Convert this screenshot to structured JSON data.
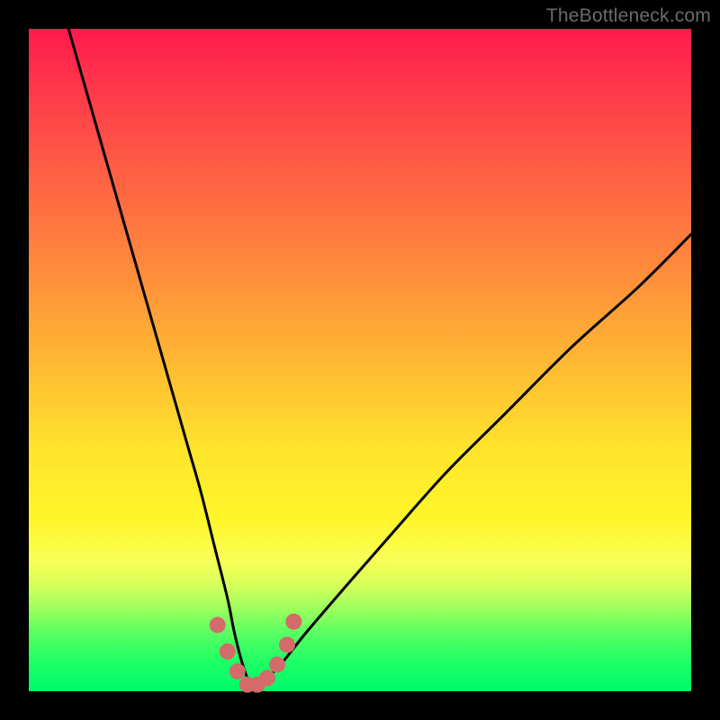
{
  "watermark": "TheBottleneck.com",
  "chart_data": {
    "type": "line",
    "title": "",
    "xlabel": "",
    "ylabel": "",
    "xlim": [
      0,
      100
    ],
    "ylim": [
      0,
      100
    ],
    "series": [
      {
        "name": "bottleneck-curve",
        "x": [
          6,
          10,
          14,
          18,
          22,
          24,
          26,
          28,
          30,
          31,
          32,
          33,
          34,
          35,
          36,
          38,
          42,
          48,
          55,
          63,
          72,
          82,
          92,
          100
        ],
        "y": [
          100,
          86,
          72,
          58,
          44,
          37,
          30,
          22,
          14,
          9,
          5,
          2,
          1,
          1,
          2,
          4,
          9,
          16,
          24,
          33,
          42,
          52,
          61,
          69
        ]
      }
    ],
    "highlight_points": {
      "name": "trough-highlight",
      "x": [
        28.5,
        30.0,
        31.5,
        33.0,
        34.5,
        36.0,
        37.5,
        39.0,
        40.0
      ],
      "y": [
        10.0,
        6.0,
        3.0,
        1.0,
        1.0,
        2.0,
        4.0,
        7.0,
        10.5
      ]
    }
  }
}
